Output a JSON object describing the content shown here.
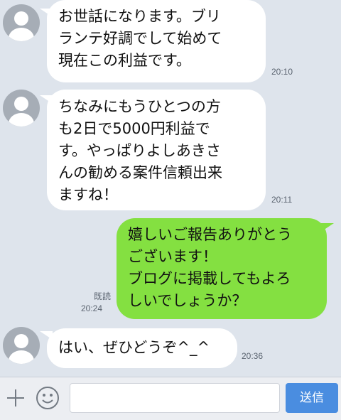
{
  "messages": [
    {
      "sender": "other",
      "lines": [
        "お世話になります。ブリ",
        "ランテ好調でして始めて",
        "現在この利益です。"
      ],
      "time": "20:10"
    },
    {
      "sender": "other",
      "lines": [
        "ちなみにもうひとつの方",
        "も2日で5000円利益で",
        "す。やっぱりよしあきさ",
        "んの勧める案件信頼出来",
        "ますね！"
      ],
      "time": "20:11"
    },
    {
      "sender": "me",
      "lines": [
        "嬉しいご報告ありがとう",
        "ございます！",
        "ブログに掲載してもよろ",
        "しいでしょうか？"
      ],
      "read": "既読",
      "time": "20:24"
    },
    {
      "sender": "other",
      "lines": [
        "はい、ぜひどうぞ^_^"
      ],
      "time": "20:36"
    }
  ],
  "input": {
    "value": ""
  },
  "send_label": "送信",
  "colors": {
    "background": "#dee4ec",
    "outgoing": "#84e041",
    "incoming": "#ffffff",
    "send": "#4a8de0"
  }
}
